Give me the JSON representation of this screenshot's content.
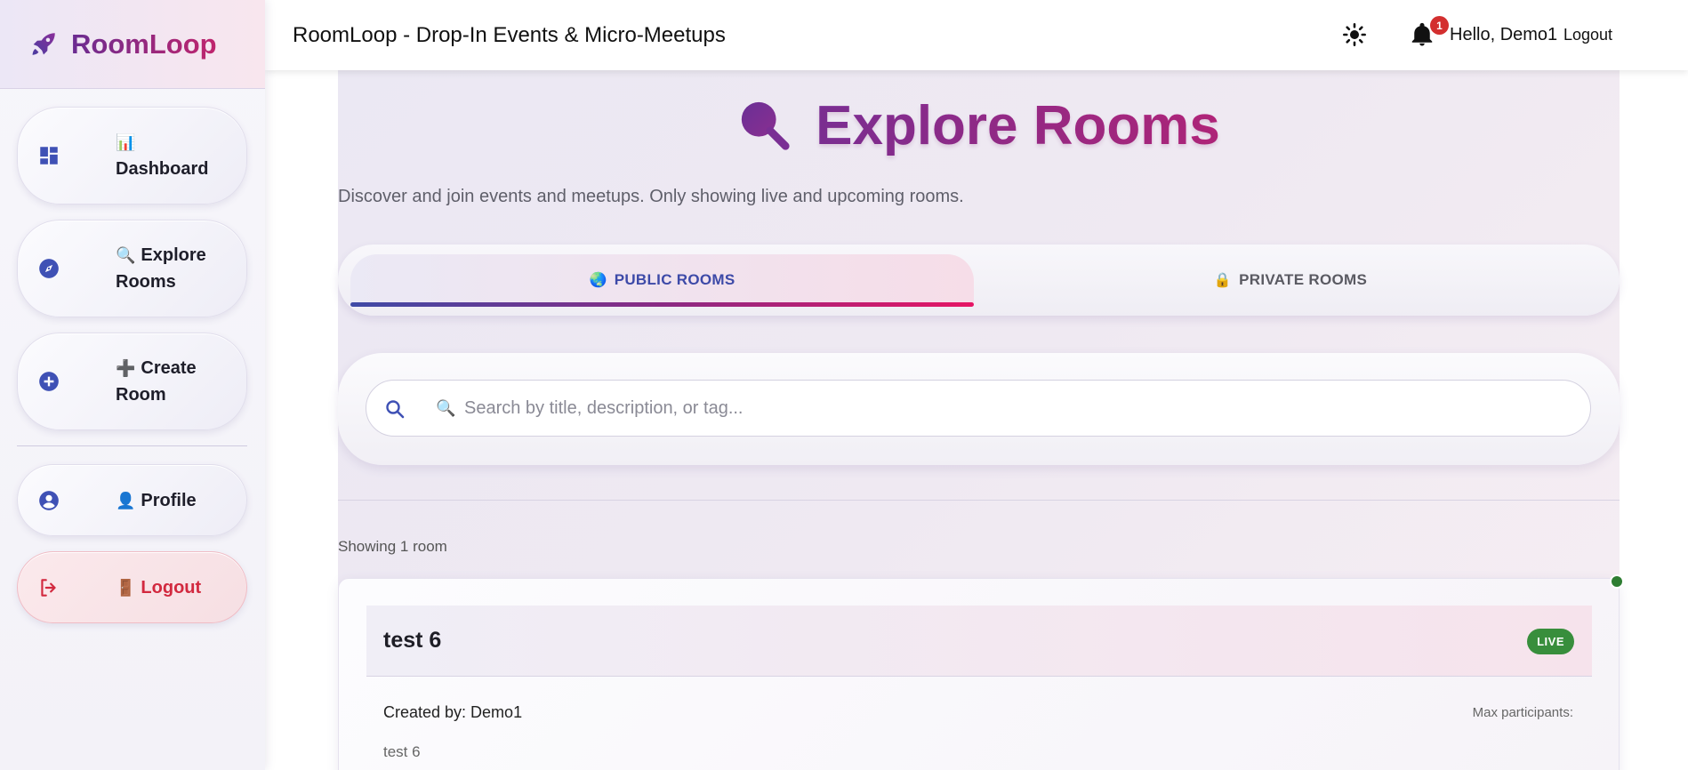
{
  "brand": {
    "name": "RoomLoop"
  },
  "sidebar": {
    "items": [
      {
        "emoji": "📊",
        "label": "Dashboard",
        "icon": "dashboard-icon"
      },
      {
        "emoji": "🔍",
        "label": "Explore Rooms",
        "icon": "compass-icon"
      },
      {
        "emoji": "➕",
        "label": "Create Room",
        "icon": "plus-circle-icon"
      },
      {
        "emoji": "👤",
        "label": "Profile",
        "icon": "account-circle-icon"
      },
      {
        "emoji": "🚪",
        "label": "Logout",
        "icon": "logout-icon"
      }
    ]
  },
  "topbar": {
    "title": "RoomLoop - Drop-In Events & Micro-Meetups",
    "notification_count": "1",
    "greeting": "Hello, Demo1",
    "logout_label": "Logout"
  },
  "main": {
    "heading": "Explore Rooms",
    "subtitle": "Discover and join events and meetups. Only showing live and upcoming rooms.",
    "tabs": [
      {
        "emoji": "🌏",
        "label": "PUBLIC ROOMS",
        "active": true
      },
      {
        "emoji": "🔒",
        "label": "PRIVATE ROOMS",
        "active": false
      }
    ],
    "search": {
      "emoji": "🔍",
      "placeholder": "Search by title, description, or tag..."
    },
    "count_text": "Showing 1 room",
    "rooms": [
      {
        "title": "test 6",
        "status": "LIVE",
        "created_by": "Created by: Demo1",
        "max_participants": "Max participants:",
        "description": "test 6"
      }
    ]
  },
  "colors": {
    "brand_gradient_start": "#6a2c91",
    "brand_gradient_end": "#c0256d",
    "accent_blue": "#3d4aa8",
    "accent_pink": "#e61565",
    "live_green": "#388e3c",
    "logout_red": "#d2293f",
    "badge_red": "#d32f2f"
  }
}
